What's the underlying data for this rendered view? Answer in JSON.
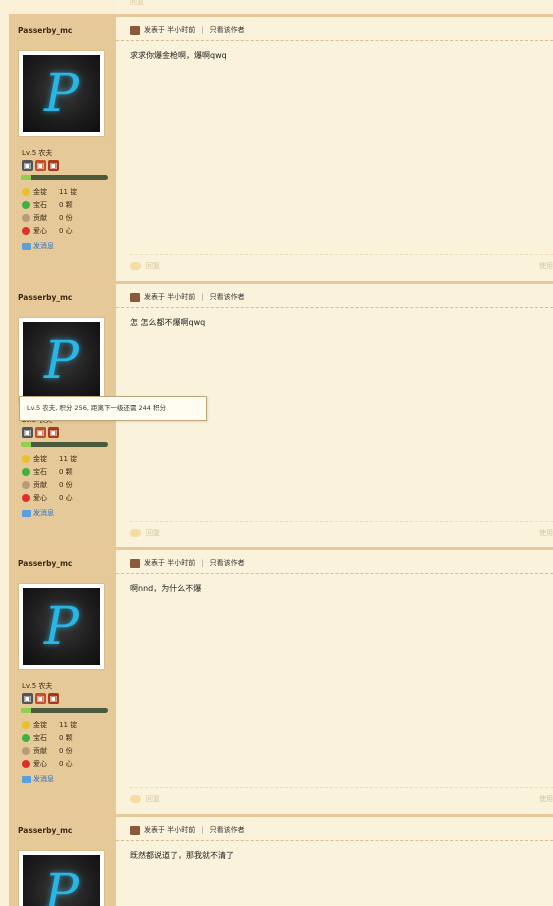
{
  "top_fragment": {
    "reply_label": "回复",
    "edit_label": "编辑"
  },
  "posts": [
    {
      "username": "Passerby_mc",
      "avatar_letter": "P",
      "level": "Lv.5 农夫",
      "exp_fraction": 0.12,
      "stats": [
        {
          "label": "金锭",
          "value": "11 锭"
        },
        {
          "label": "宝石",
          "value": "0 颗"
        },
        {
          "label": "贡献",
          "value": "0 份"
        },
        {
          "label": "爱心",
          "value": "0 心"
        }
      ],
      "message_label": "发消息",
      "posted": "发表于 半小时前",
      "only_author": "只看该作者",
      "content": "求求你爆金枪啊，爆啊qwq",
      "reply_label": "回复",
      "use_label": "使用"
    },
    {
      "username": "Passerby_mc",
      "avatar_letter": "P",
      "level": "Lv.5 农夫",
      "exp_fraction": 0.12,
      "stats": [
        {
          "label": "金锭",
          "value": "11 锭"
        },
        {
          "label": "宝石",
          "value": "0 颗"
        },
        {
          "label": "贡献",
          "value": "0 份"
        },
        {
          "label": "爱心",
          "value": "0 心"
        }
      ],
      "message_label": "发消息",
      "posted": "发表于 半小时前",
      "only_author": "只看该作者",
      "content": "怎 怎么都不爆啊qwq",
      "reply_label": "回复",
      "use_label": "使用"
    },
    {
      "username": "Passerby_mc",
      "avatar_letter": "P",
      "level": "Lv.5 农夫",
      "exp_fraction": 0.12,
      "stats": [
        {
          "label": "金锭",
          "value": "11 锭"
        },
        {
          "label": "宝石",
          "value": "0 颗"
        },
        {
          "label": "贡献",
          "value": "0 份"
        },
        {
          "label": "爱心",
          "value": "0 心"
        }
      ],
      "message_label": "发消息",
      "posted": "发表于 半小时前",
      "only_author": "只看该作者",
      "content": "啊nnd，为什么不爆",
      "reply_label": "回复",
      "use_label": "使用"
    },
    {
      "username": "Passerby_mc",
      "avatar_letter": "P",
      "posted": "发表于 半小时前",
      "only_author": "只看该作者",
      "content": "既然都说道了，那我就不清了"
    }
  ],
  "tooltip": {
    "text": "Lv.5 农夫, 积分 256, 距离下一级还需 244 积分"
  }
}
